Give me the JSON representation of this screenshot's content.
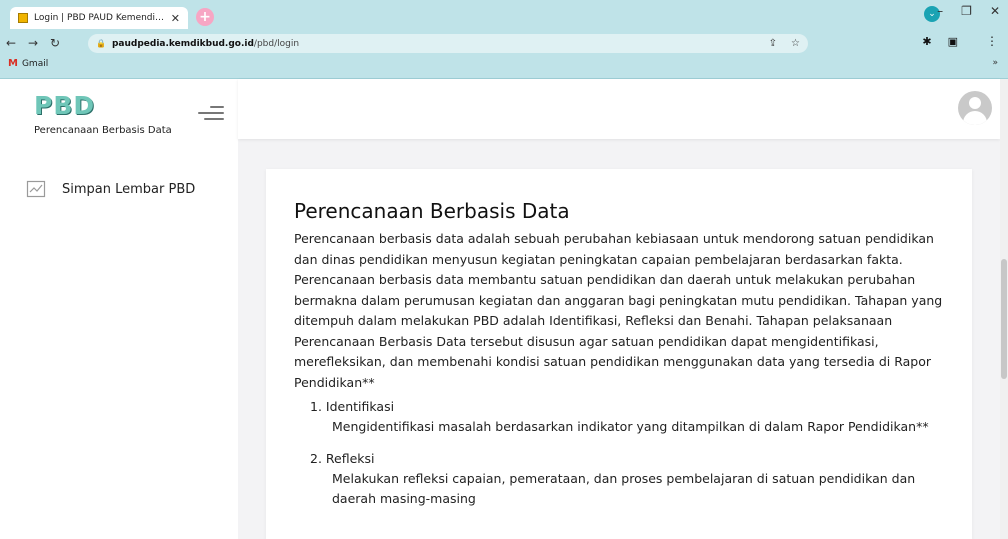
{
  "browser": {
    "tab_title": "Login | PBD PAUD Kemendikbud",
    "tab_close": "✕",
    "new_tab": "+",
    "url_host": "paudpedia.kemdikbud.go.id",
    "url_path": "/pbd/login",
    "bookmark_label": "Gmail",
    "bookmark_more": "»"
  },
  "sidebar": {
    "brand": "PBD",
    "brand_subtitle": "Perencanaan Berbasis Data",
    "items": [
      {
        "label": "Simpan Lembar PBD",
        "icon": "chart-line-icon"
      }
    ]
  },
  "content": {
    "title": "Perencanaan Berbasis Data",
    "intro": "Perencanaan berbasis data adalah sebuah perubahan kebiasaan untuk mendorong satuan pendidikan dan dinas pendidikan menyusun kegiatan peningkatan capaian pembelajaran berdasarkan fakta. Perencanaan berbasis data membantu satuan pendidikan dan daerah untuk melakukan perubahan bermakna dalam perumusan kegiatan dan anggaran bagi peningkatan mutu pendidikan. Tahapan yang ditempuh dalam melakukan PBD adalah Identifikasi, Refleksi dan Benahi. Tahapan pelaksanaan Perencanaan Berbasis Data tersebut disusun agar satuan pendidikan dapat mengidentifikasi, merefleksikan, dan membenahi kondisi satuan pendidikan menggunakan data yang tersedia di Rapor Pendidikan**",
    "steps": [
      {
        "number": "1.",
        "title": "Identifikasi",
        "desc": "Mengidentifikasi masalah berdasarkan indikator yang ditampilkan di dalam Rapor Pendidikan**"
      },
      {
        "number": "2.",
        "title": "Refleksi",
        "desc": "Melakukan refleksi capaian, pemerataan, dan proses pembelajaran di satuan pendidikan dan daerah masing-masing"
      }
    ]
  },
  "colors": {
    "browser_chrome": "#bfe3e8",
    "brand": "#6fc6b8",
    "accent_pink": "#f7a6c4",
    "main_bg": "#f3f3f5"
  }
}
